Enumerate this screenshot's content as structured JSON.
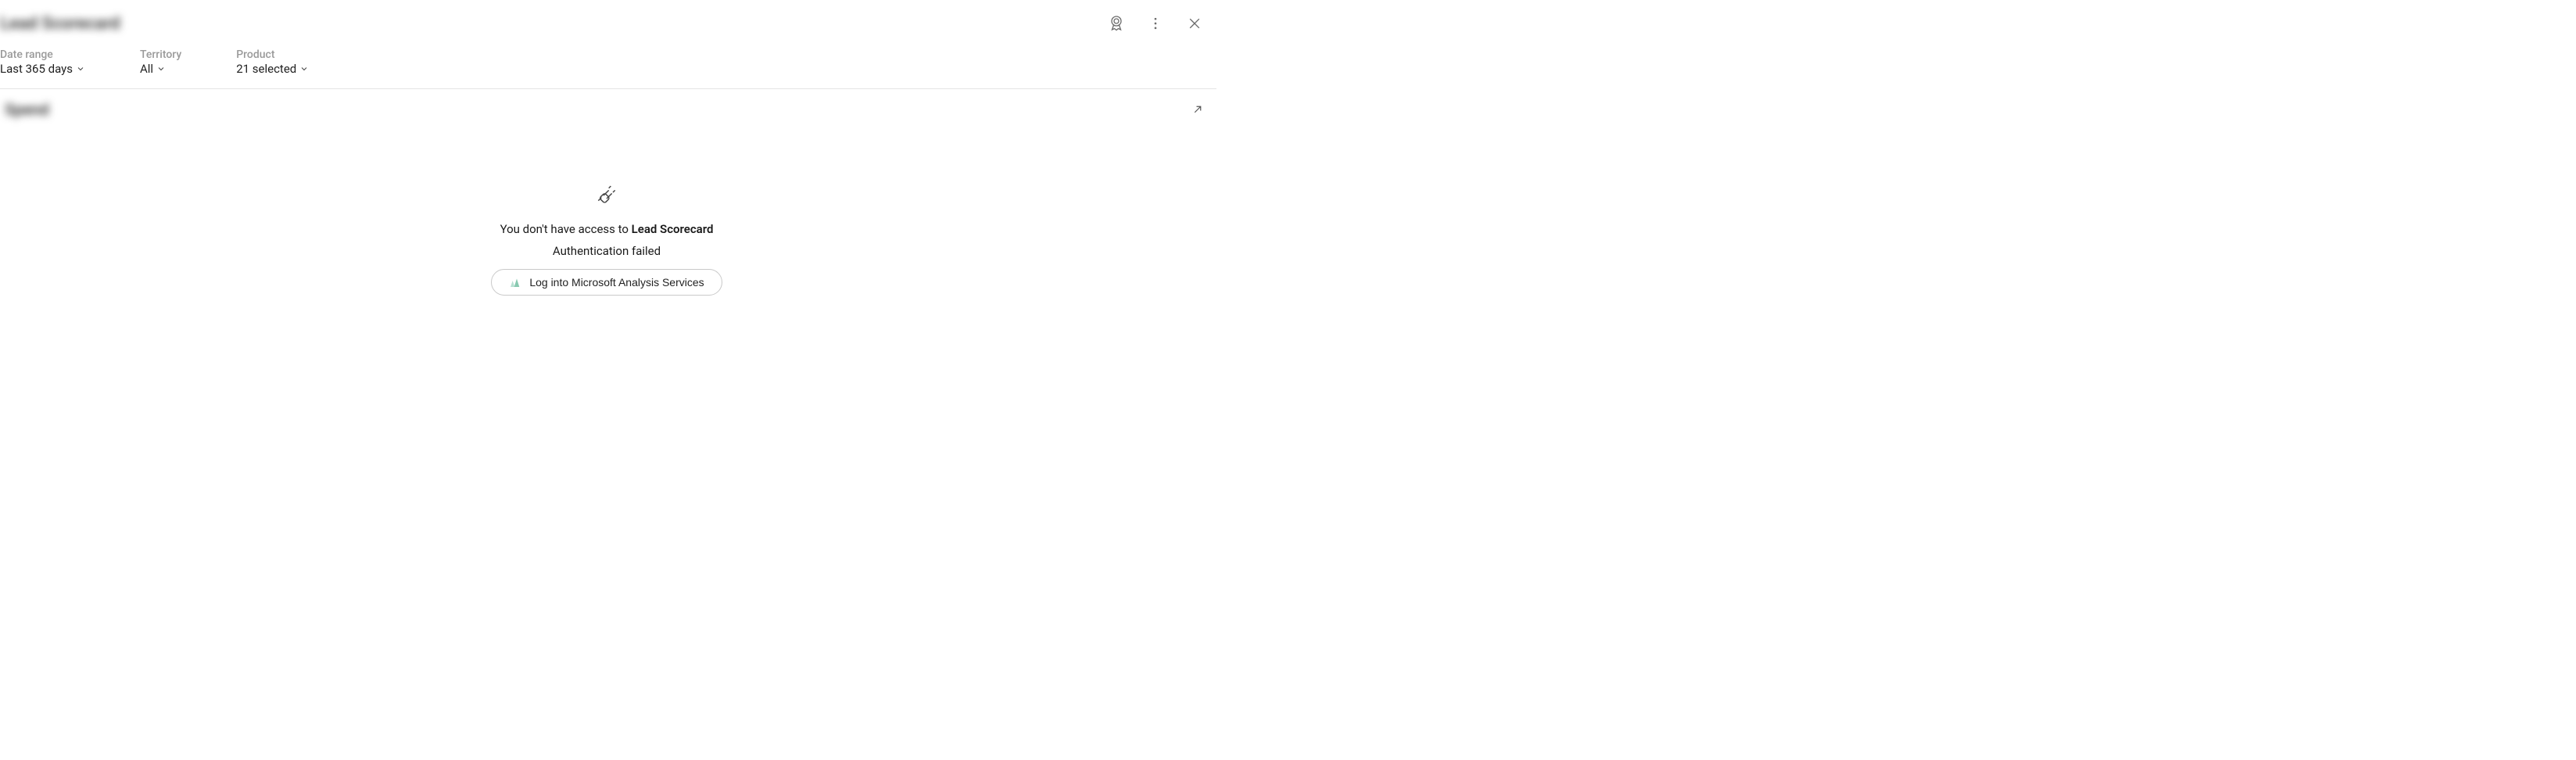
{
  "header": {
    "title": "Lead Scorecard"
  },
  "filters": {
    "date_range": {
      "label": "Date range",
      "value": "Last 365 days"
    },
    "territory": {
      "label": "Territory",
      "value": "All"
    },
    "product": {
      "label": "Product",
      "value": "21 selected"
    }
  },
  "section": {
    "title": "Spend"
  },
  "error": {
    "line1_prefix": "You don't have access to ",
    "line1_resource": "Lead Scorecard",
    "line2": "Authentication failed",
    "login_button": "Log into Microsoft Analysis Services"
  }
}
